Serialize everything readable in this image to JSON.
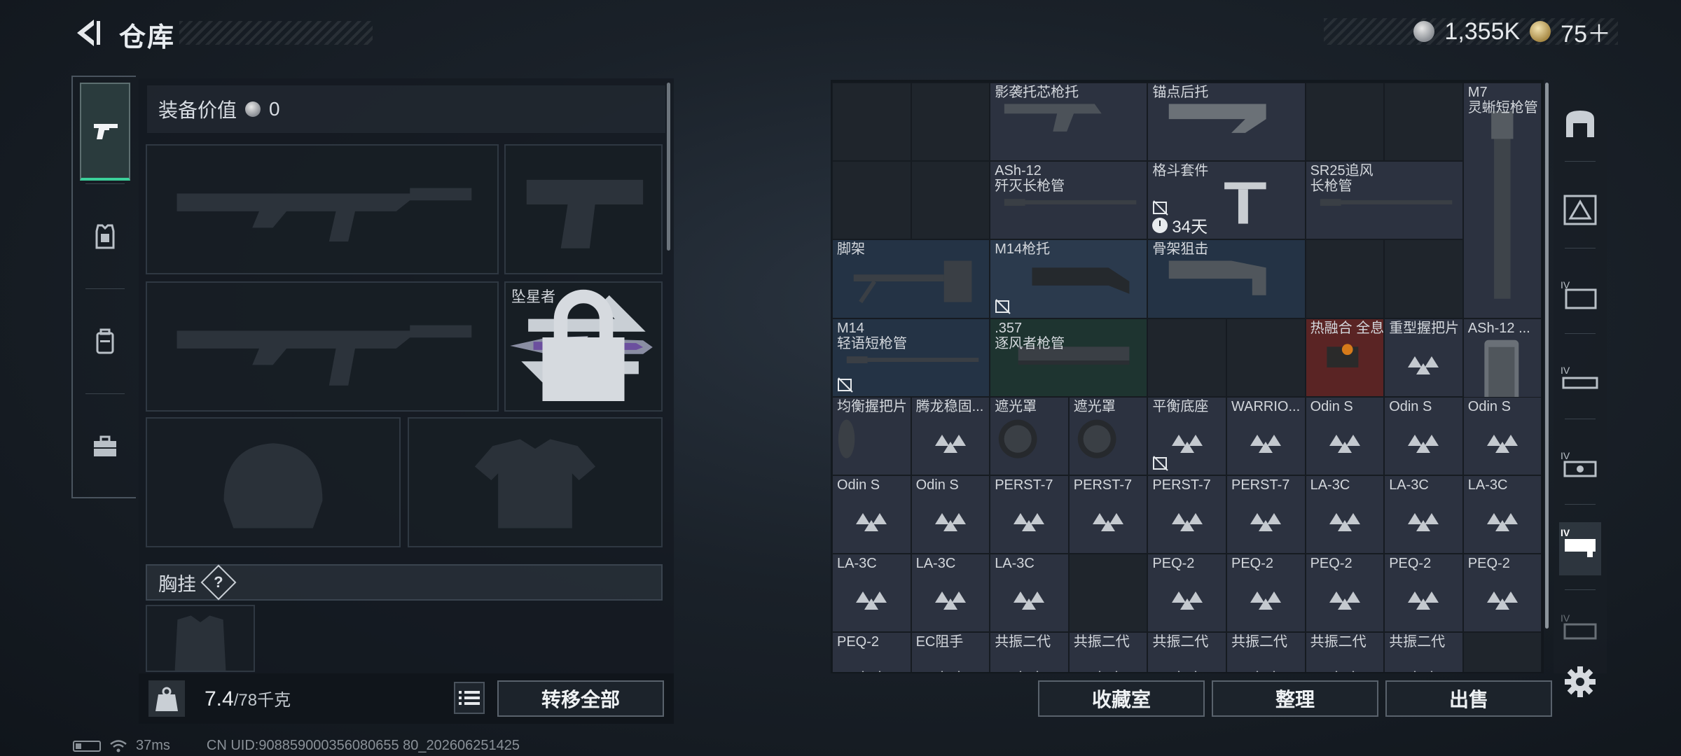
{
  "header": {
    "title": "仓库"
  },
  "currency": {
    "silver": "1,355K",
    "gold": "75＋"
  },
  "tabs": [
    {
      "name": "weapons",
      "active": true
    },
    {
      "name": "armor",
      "active": false
    },
    {
      "name": "backpack",
      "active": false
    },
    {
      "name": "toolbox",
      "active": false
    }
  ],
  "loadout": {
    "equip_value_label": "装备价值",
    "equip_value": "0",
    "melee_label": "坠星者",
    "chest_label": "胸挂",
    "help": "?"
  },
  "footer_left": {
    "weight_current": "7.4",
    "weight_max": "/78千克",
    "transfer_all": "转移全部"
  },
  "footer_right": {
    "collection": "收藏室",
    "organize": "整理",
    "sell": "出售"
  },
  "status": {
    "ping": "37ms",
    "uid": "CN UID:908859000356080655 80_202606251425"
  },
  "inventory": {
    "items": [
      {
        "name": "影袭托芯枪托"
      },
      {
        "name": "锚点后托"
      },
      {
        "name": "M7\n灵蜥短枪管"
      },
      {
        "name": "ASh-12\n歼灭长枪管"
      },
      {
        "name": "格斗套件",
        "timer": "34天"
      },
      {
        "name": "SR25追风\n长枪管"
      },
      {
        "name": "脚架"
      },
      {
        "name": "M14枪托"
      },
      {
        "name": "骨架狙击"
      },
      {
        "name": "ASh-12 ..."
      },
      {
        "name": "M14\n轻语短枪管"
      },
      {
        "name": ".357\n逐风者枪管"
      },
      {
        "name": "热融合 全息"
      },
      {
        "name": "重型握把片"
      },
      {
        "name": "均衡握把片"
      },
      {
        "name": "腾龙稳固..."
      },
      {
        "name": "遮光罩"
      },
      {
        "name": "遮光罩"
      },
      {
        "name": "平衡底座"
      },
      {
        "name": "WARRIO..."
      },
      {
        "name": "Odin S"
      },
      {
        "name": "Odin S"
      },
      {
        "name": "Odin S"
      },
      {
        "name": "Odin S"
      },
      {
        "name": "Odin S"
      },
      {
        "name": "PERST-7"
      },
      {
        "name": "PERST-7"
      },
      {
        "name": "PERST-7"
      },
      {
        "name": "PERST-7"
      },
      {
        "name": "LA-3C"
      },
      {
        "name": "LA-3C"
      },
      {
        "name": "LA-3C"
      },
      {
        "name": "LA-3C"
      },
      {
        "name": "LA-3C"
      },
      {
        "name": "LA-3C"
      },
      {
        "name": "PEQ-2"
      },
      {
        "name": "PEQ-2"
      },
      {
        "name": "PEQ-2"
      },
      {
        "name": "PEQ-2"
      },
      {
        "name": "PEQ-2"
      },
      {
        "name": "PEQ-2"
      },
      {
        "name": "EC阻手"
      },
      {
        "name": "共振二代"
      },
      {
        "name": "共振二代"
      },
      {
        "name": "共振二代"
      },
      {
        "name": "共振二代"
      },
      {
        "name": "共振二代"
      },
      {
        "name": "共振二代"
      }
    ]
  },
  "category_rail": [
    "grip-icon",
    "sight-icon",
    "magazine-icon",
    "muzzle-icon",
    "scope-icon",
    "laser-icon",
    "misc-icon"
  ],
  "colors": {
    "accent": "#3bd09a",
    "rare_red": "#5a2424",
    "item_blue": "#243345"
  }
}
